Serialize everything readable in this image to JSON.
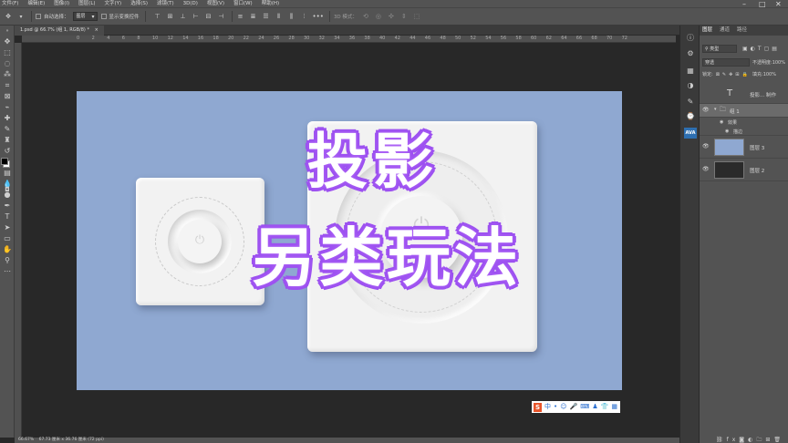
{
  "menu": [
    "文件(F)",
    "编辑(E)",
    "图像(I)",
    "图层(L)",
    "文字(Y)",
    "选择(S)",
    "滤镜(T)",
    "3D(D)",
    "视图(V)",
    "窗口(W)",
    "帮助(H)"
  ],
  "options": {
    "auto_select_label": "自动选择：",
    "auto_select_value": "图层",
    "show_transform_label": "显示变换控件",
    "mode_3d_label": "3D 模式："
  },
  "document": {
    "tab_title": "1.psd @ 66.7% (组 1, RGB/8) *",
    "ruler_marks": [
      "0",
      "2",
      "4",
      "6",
      "8",
      "10",
      "12",
      "14",
      "16",
      "18",
      "20",
      "22",
      "24",
      "26",
      "28",
      "30",
      "32",
      "34",
      "36",
      "38",
      "40",
      "42",
      "44",
      "46",
      "48",
      "50",
      "52",
      "54",
      "56",
      "58",
      "60",
      "62",
      "64",
      "66",
      "68",
      "70",
      "72"
    ]
  },
  "canvas": {
    "background_color": "#8fa8d1",
    "headline_line1": "投影",
    "headline_line2": "另类玩法",
    "headline_stroke_color": "#a855f7"
  },
  "ime_bar": {
    "logo": "S",
    "mode": "中",
    "icons": [
      "dot-icon",
      "emoji-icon",
      "mic-icon",
      "keyboard-icon",
      "clothes-icon",
      "shirt-icon",
      "grid-icon"
    ]
  },
  "status": {
    "zoom": "66.67%",
    "doc_size": "67.73 厘米 x 36.76 厘米 (72 ppi)"
  },
  "layers_panel": {
    "tabs": [
      "图层",
      "通道",
      "路径"
    ],
    "filter_label": "类型",
    "blend_mode": "穿透",
    "opacity_label": "不透明度:",
    "opacity_value": "100%",
    "lock_label": "锁定:",
    "fill_label": "填充:",
    "fill_value": "100%",
    "layers": [
      {
        "name": "投影... 制作",
        "kind": "text"
      },
      {
        "name": "组 1",
        "kind": "group"
      },
      {
        "name": "效果",
        "kind": "effect"
      },
      {
        "name": "描边",
        "kind": "effect"
      },
      {
        "name": "图层 3",
        "kind": "pixel",
        "thumb_color": "#8fa8d1"
      },
      {
        "name": "图层 2",
        "kind": "pixel",
        "thumb_color": "#2a2a2a"
      }
    ]
  }
}
